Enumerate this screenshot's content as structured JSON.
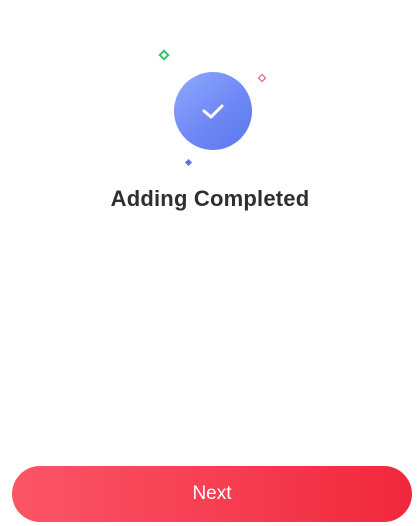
{
  "status": {
    "title": "Adding Completed",
    "icon": "check-icon"
  },
  "actions": {
    "next_label": "Next"
  },
  "colors": {
    "badge": "#6f88f6",
    "button": "#f53b4e",
    "sparkle_green": "#35c26b",
    "sparkle_red": "#f0445a",
    "sparkle_blue": "#5b74e8",
    "title_text": "#2e2e33"
  }
}
